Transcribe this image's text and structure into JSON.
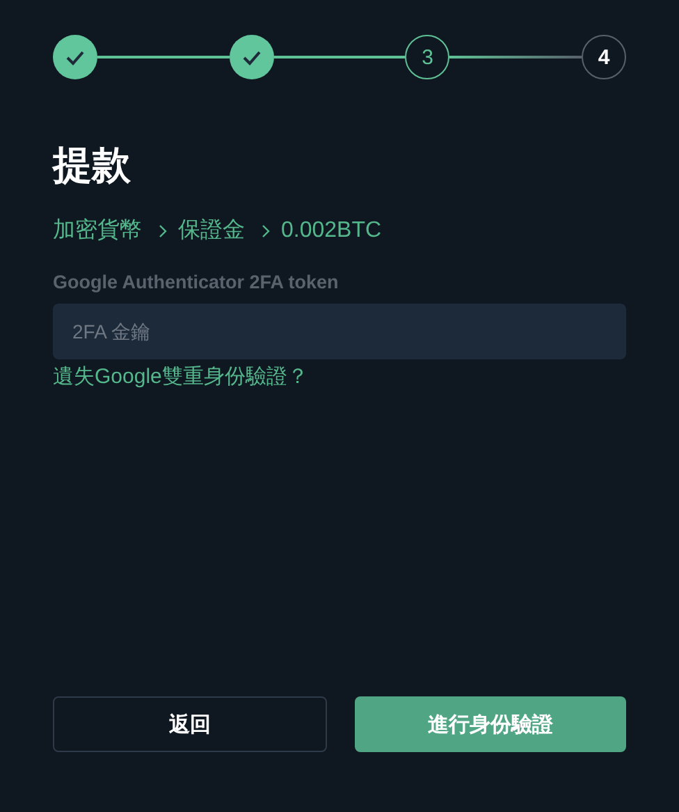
{
  "steps": [
    {
      "completed": true,
      "selected": false
    },
    {
      "completed": true,
      "selected": false
    },
    {
      "label": "3",
      "completed": false,
      "selected": true
    },
    {
      "label": "4",
      "completed": false,
      "selected": false
    }
  ],
  "title": "提款",
  "breadcrumb": [
    "加密貨幣",
    "保證金",
    "0.002BTC"
  ],
  "field": {
    "label": "Google Authenticator 2FA token",
    "placeholder": "2FA 金鑰"
  },
  "help_link": "遺失Google雙重身份驗證？",
  "buttons": [
    {
      "label": "返回",
      "kind": "secondary"
    },
    {
      "label": "進行身份驗證",
      "kind": "primary"
    }
  ]
}
